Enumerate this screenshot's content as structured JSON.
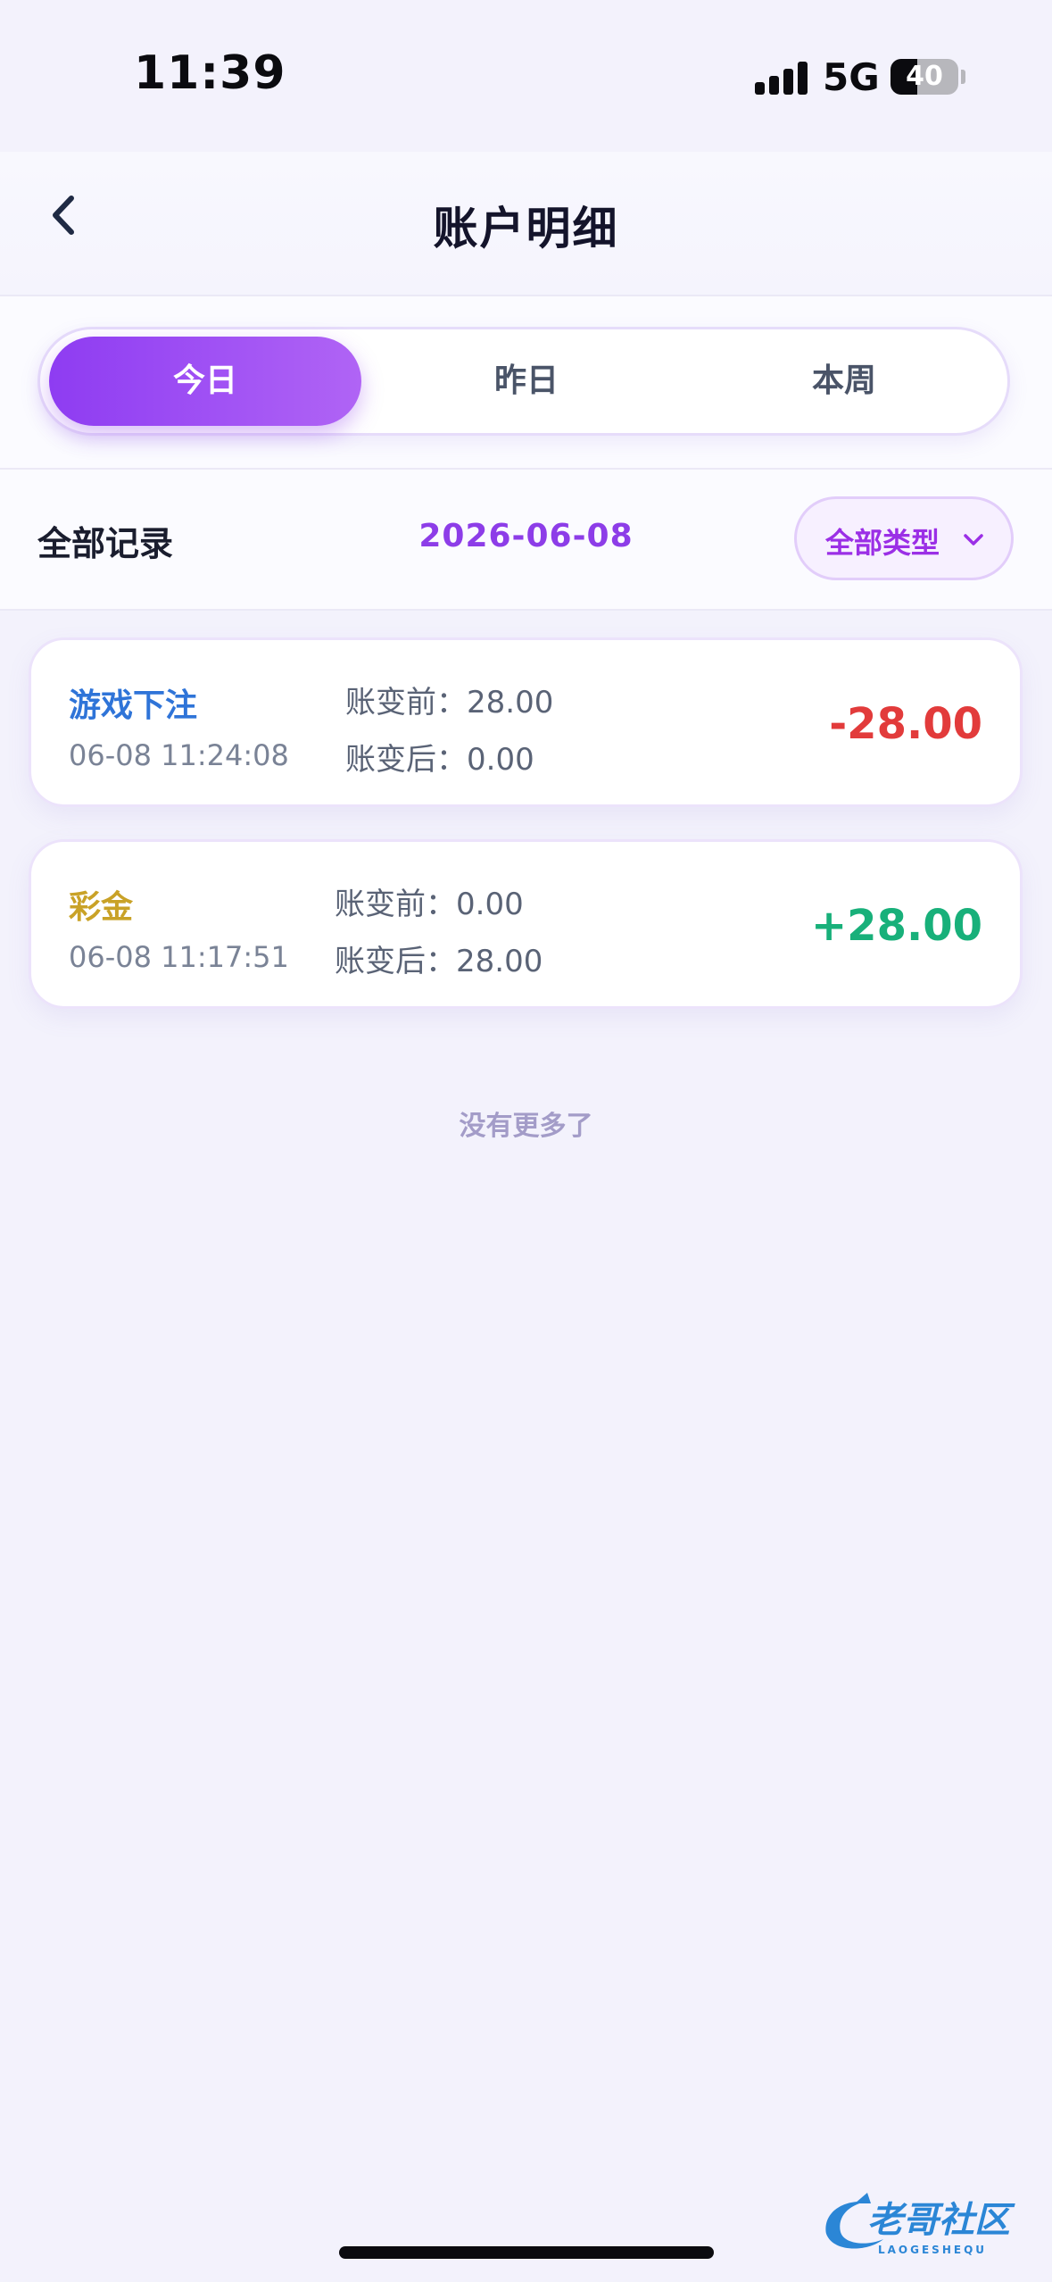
{
  "status_bar": {
    "time": "11:39",
    "network": "5G",
    "battery_level": "40",
    "battery_fraction": 0.4
  },
  "header": {
    "title": "账户明细",
    "back_icon": "chevron-left-icon"
  },
  "tabs": [
    {
      "label": "今日",
      "active": true
    },
    {
      "label": "昨日",
      "active": false
    },
    {
      "label": "本周",
      "active": false
    }
  ],
  "filter": {
    "label": "全部记录",
    "date": "2026-06-08",
    "type_select": "全部类型",
    "type_icon": "chevron-down-icon"
  },
  "records": [
    {
      "type": "游戏下注",
      "time": "06-08 11:24:08",
      "before_label": "账变前：",
      "before_value": "28.00",
      "after_label": "账变后：",
      "after_value": "0.00",
      "amount": "-28.00",
      "type_color": "#2f74d8",
      "amount_color": "#e23b3b"
    },
    {
      "type": "彩金",
      "time": "06-08 11:17:51",
      "before_label": "账变前：",
      "before_value": "0.00",
      "after_label": "账变后：",
      "after_value": "28.00",
      "amount": "+28.00",
      "type_color": "#c9a227",
      "amount_color": "#18b07a"
    }
  ],
  "list_footer": "没有更多了",
  "watermark": {
    "text": "老哥社区",
    "subtext": "LAOGESHEQU"
  },
  "colors": {
    "accent": "#8e3cf2",
    "background": "#f3f2fc"
  }
}
